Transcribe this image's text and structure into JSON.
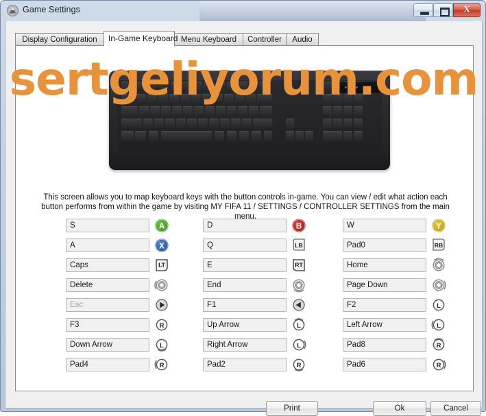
{
  "window": {
    "title": "Game Settings",
    "app_icon": "mountain-icon",
    "controls": {
      "minimize": "minimize-icon",
      "maximize": "maximize-icon",
      "close": "X"
    }
  },
  "tabs": [
    {
      "label": "Display Configuration",
      "active": false
    },
    {
      "label": "In-Game Keyboard",
      "active": true
    },
    {
      "label": "Menu Keyboard",
      "active": false
    },
    {
      "label": "Controller",
      "active": false
    },
    {
      "label": "Audio",
      "active": false
    }
  ],
  "watermark": {
    "text": "sertgeliyorum.com",
    "color": "#e8923a"
  },
  "image": {
    "name": "keyboard-illustration"
  },
  "description": "This screen allows you to map keyboard keys with the button controls in-game. You can view / edit what action each button performs from within the game by visiting MY FIFA 11 / SETTINGS / CONTROLLER SETTINGS from the main menu.",
  "colors": {
    "button_a": "#3f9e28",
    "button_b": "#b31f16",
    "button_x": "#2b59a8",
    "button_y": "#c8a412",
    "watermark": "#e8923a",
    "close_button": "#c03a27"
  },
  "mappings": {
    "columns": [
      {
        "rows": [
          {
            "key": "S",
            "icon": "button-a-icon",
            "disabled": false
          },
          {
            "key": "A",
            "icon": "button-x-icon",
            "disabled": false
          },
          {
            "key": "Caps",
            "icon": "left-trigger-lt-icon",
            "disabled": false
          },
          {
            "key": "Delete",
            "icon": "left-stick-left-icon",
            "disabled": false
          },
          {
            "key": "Esc",
            "icon": "start-button-icon",
            "disabled": true
          },
          {
            "key": "F3",
            "icon": "right-stick-icon",
            "disabled": false
          },
          {
            "key": "Down Arrow",
            "icon": "left-stick-down-icon",
            "disabled": false
          },
          {
            "key": "Pad4",
            "icon": "right-stick-left-icon",
            "disabled": false
          }
        ]
      },
      {
        "rows": [
          {
            "key": "D",
            "icon": "button-b-icon",
            "disabled": false
          },
          {
            "key": "Q",
            "icon": "left-bumper-lb-icon",
            "disabled": false
          },
          {
            "key": "E",
            "icon": "right-trigger-rt-icon",
            "disabled": false
          },
          {
            "key": "End",
            "icon": "left-stick-down2-icon",
            "disabled": false
          },
          {
            "key": "F1",
            "icon": "back-button-icon",
            "disabled": false
          },
          {
            "key": "Up Arrow",
            "icon": "left-stick-up-icon",
            "disabled": false
          },
          {
            "key": "Right Arrow",
            "icon": "left-stick-right-icon",
            "disabled": false
          },
          {
            "key": "Pad2",
            "icon": "right-stick-down-icon",
            "disabled": false
          }
        ]
      },
      {
        "rows": [
          {
            "key": "W",
            "icon": "button-y-icon",
            "disabled": false
          },
          {
            "key": "Pad0",
            "icon": "right-bumper-rb-icon",
            "disabled": false
          },
          {
            "key": "Home",
            "icon": "right-stick-up2-icon",
            "disabled": false
          },
          {
            "key": "Page Down",
            "icon": "right-stick-right2-icon",
            "disabled": false
          },
          {
            "key": "F2",
            "icon": "left-stick-l-icon",
            "disabled": false
          },
          {
            "key": "Left Arrow",
            "icon": "left-stick-left2-icon",
            "disabled": false
          },
          {
            "key": "Pad8",
            "icon": "right-stick-up-icon",
            "disabled": false
          },
          {
            "key": "Pad6",
            "icon": "right-stick-right-icon",
            "disabled": false
          }
        ]
      }
    ]
  },
  "footer": {
    "print_label": "Print",
    "ok_label": "Ok",
    "cancel_label": "Cancel"
  }
}
